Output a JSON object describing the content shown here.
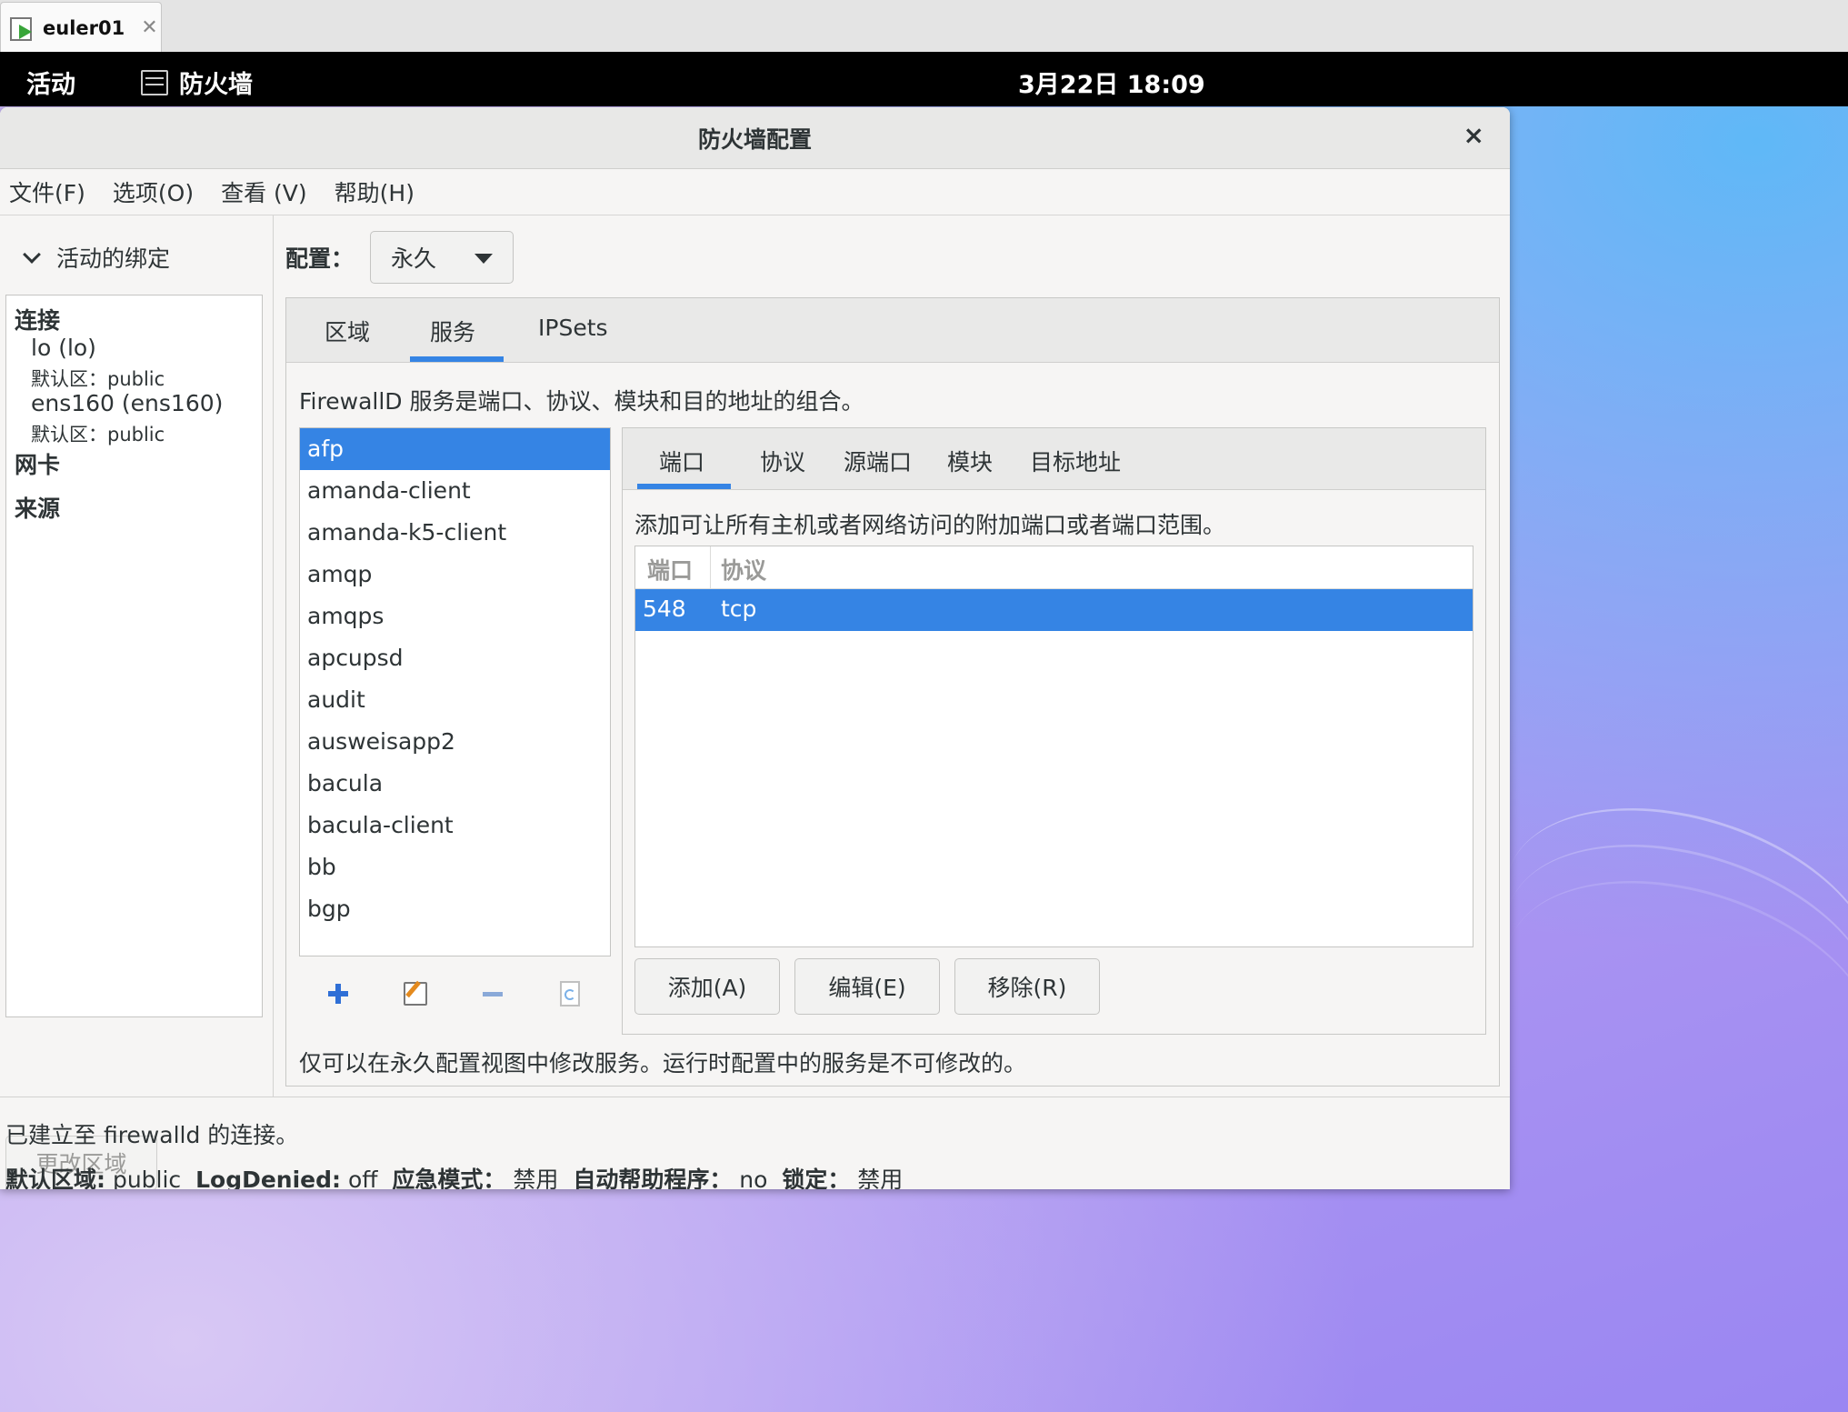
{
  "vm_tab": {
    "title": "euler01",
    "close_glyph": "✕"
  },
  "topbar": {
    "activities": "活动",
    "app_name": "防火墙",
    "clock": "3月22日  18:09"
  },
  "window": {
    "title": "防火墙配置",
    "close_glyph": "×",
    "menu": [
      "文件(F)",
      "选项(O)",
      "查看 (V)",
      "帮助(H)"
    ]
  },
  "left": {
    "section_header": "活动的绑定",
    "group_connections": "连接",
    "connections": [
      {
        "name": "lo (lo)",
        "zone": "默认区：public"
      },
      {
        "name": "ens160 (ens160)",
        "zone": "默认区：public"
      }
    ],
    "group_nics": "网卡",
    "group_sources": "来源",
    "change_zone_button": "更改区域"
  },
  "config": {
    "label": "配置：",
    "value": "永久"
  },
  "main_tabs": [
    "区域",
    "服务",
    "IPSets"
  ],
  "main_tab_active": "服务",
  "services": {
    "description": "FirewallD 服务是端口、协议、模块和目的地址的组合。",
    "items": [
      "afp",
      "amanda-client",
      "amanda-k5-client",
      "amqp",
      "amqps",
      "apcupsd",
      "audit",
      "ausweisapp2",
      "bacula",
      "bacula-client",
      "bb",
      "bgp"
    ],
    "selected": "afp",
    "note": "仅可以在永久配置视图中修改服务。运行时配置中的服务是不可修改的。"
  },
  "sub_tabs": [
    "端口",
    "协议",
    "源端口",
    "模块",
    "目标地址"
  ],
  "sub_tab_active": "端口",
  "ports": {
    "description": "添加可让所有主机或者网络访问的附加端口或者端口范围。",
    "columns": [
      "端口",
      "协议"
    ],
    "rows": [
      {
        "port": "548",
        "protocol": "tcp"
      }
    ],
    "buttons": {
      "add": "添加(A)",
      "edit": "编辑(E)",
      "remove": "移除(R)"
    }
  },
  "status": {
    "connection": "已建立至 firewalld 的连接。",
    "default_zone_label": "默认区域:",
    "default_zone_value": "public",
    "logdenied_label": "LogDenied:",
    "logdenied_value": "off",
    "panic_label": "应急模式：",
    "panic_value": "禁用",
    "helper_label": "自动帮助程序：",
    "helper_value": "no",
    "lock_label": "锁定：",
    "lock_value": "禁用"
  },
  "colors": {
    "accent": "#3584e4",
    "topbar": "#000000"
  }
}
